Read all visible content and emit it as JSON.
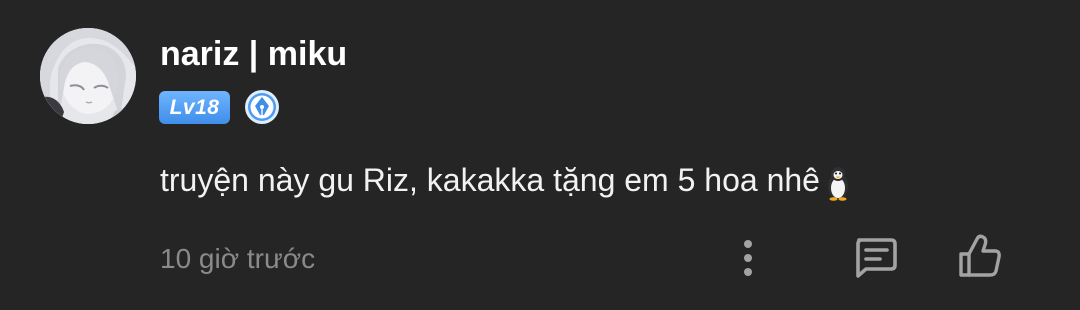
{
  "comment": {
    "user": {
      "name": "nariz | miku",
      "level": "Lv18",
      "avatar_icon": "anime-girl-avatar",
      "badge_icon": "pen-nib-badge-icon"
    },
    "text": "truyện này gu Riz, kakakka tặng em 5 hoa nhê",
    "emoji": "penguin",
    "timestamp": "10 giờ trước",
    "actions": {
      "more_icon": "more-vertical-icon",
      "reply_icon": "comment-reply-icon",
      "like_icon": "thumbs-up-icon"
    }
  },
  "colors": {
    "background": "#252525",
    "username": "#ffffff",
    "comment_text": "#f2f2f2",
    "timestamp": "#8a8a8a",
    "level_badge": "#4a97ef",
    "icon": "#a3a3a3"
  }
}
